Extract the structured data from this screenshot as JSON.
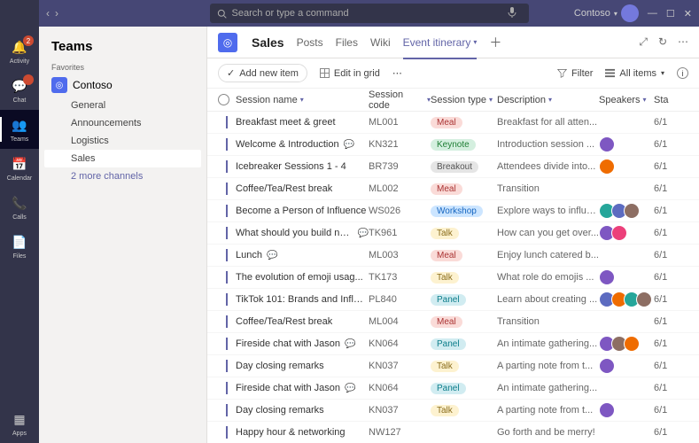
{
  "rail": {
    "items": [
      {
        "label": "Activity",
        "icon": "🔔",
        "badge": "2"
      },
      {
        "label": "Chat",
        "icon": "💬",
        "badge": " "
      },
      {
        "label": "Teams",
        "icon": "👥",
        "active": true
      },
      {
        "label": "Calendar",
        "icon": "📅"
      },
      {
        "label": "Calls",
        "icon": "📞"
      },
      {
        "label": "Files",
        "icon": "📄"
      }
    ],
    "apps_label": "Apps"
  },
  "search": {
    "placeholder": "Search or type a command"
  },
  "org": {
    "name": "Contoso"
  },
  "sidebar": {
    "title": "Teams",
    "favorites_label": "Favorites",
    "team_name": "Contoso",
    "channels": [
      {
        "name": "General"
      },
      {
        "name": "Announcements"
      },
      {
        "name": "Logistics"
      },
      {
        "name": "Sales",
        "selected": true
      },
      {
        "name": "2 more channels",
        "more": true
      }
    ]
  },
  "tabs": {
    "team_glyph": "◎",
    "title": "Sales",
    "items": [
      "Posts",
      "Files",
      "Wiki"
    ],
    "active_tab": "Event itinerary"
  },
  "cmd": {
    "new_item": "Add new item",
    "edit_grid": "Edit in grid",
    "filter": "Filter",
    "all_items": "All items"
  },
  "columns": {
    "name": "Session name",
    "code": "Session code",
    "type": "Session type",
    "desc": "Description",
    "speak": "Speakers",
    "start": "Sta"
  },
  "rows": [
    {
      "name": "Breakfast meet & greet",
      "code": "ML001",
      "type": "Meal",
      "typeClass": "meal",
      "desc": "Breakfast for all atten...",
      "speakers": [],
      "start": "6/1"
    },
    {
      "name": "Welcome & Introduction",
      "ind": true,
      "code": "KN321",
      "type": "Keynote",
      "typeClass": "keynote",
      "desc": "Introduction session ...",
      "speakers": [
        "a"
      ],
      "start": "6/1"
    },
    {
      "name": "Icebreaker Sessions 1 - 4",
      "code": "BR739",
      "type": "Breakout",
      "typeClass": "breakout",
      "desc": "Attendees divide into...",
      "speakers": [
        "b"
      ],
      "start": "6/1"
    },
    {
      "name": "Coffee/Tea/Rest break",
      "code": "ML002",
      "type": "Meal",
      "typeClass": "meal",
      "desc": "Transition",
      "speakers": [],
      "start": "6/1"
    },
    {
      "name": "Become a Person of Influence",
      "code": "WS026",
      "type": "Workshop",
      "typeClass": "workshop",
      "desc": "Explore ways to influe...",
      "speakers": [
        "c",
        "d",
        "e"
      ],
      "start": "6/1"
    },
    {
      "name": "What should you build next?",
      "ind": true,
      "code": "TK961",
      "type": "Talk",
      "typeClass": "talk",
      "desc": "How can you get over...",
      "speakers": [
        "a",
        "f"
      ],
      "start": "6/1"
    },
    {
      "name": "Lunch",
      "ind": true,
      "code": "ML003",
      "type": "Meal",
      "typeClass": "meal",
      "desc": "Enjoy lunch catered b...",
      "speakers": [],
      "start": "6/1"
    },
    {
      "name": "The evolution of emoji usag...",
      "code": "TK173",
      "type": "Talk",
      "typeClass": "talk",
      "desc": "What role do emojis ...",
      "speakers": [
        "a"
      ],
      "start": "6/1"
    },
    {
      "name": "TikTok 101: Brands and Influe...",
      "code": "PL840",
      "type": "Panel",
      "typeClass": "panel",
      "desc": "Learn about creating ...",
      "speakers": [
        "d",
        "b",
        "c",
        "e"
      ],
      "start": "6/1"
    },
    {
      "name": "Coffee/Tea/Rest break",
      "code": "ML004",
      "type": "Meal",
      "typeClass": "meal",
      "desc": "Transition",
      "speakers": [],
      "start": "6/1"
    },
    {
      "name": "Fireside chat with Jason",
      "ind": true,
      "code": "KN064",
      "type": "Panel",
      "typeClass": "panel",
      "desc": "An intimate gathering...",
      "speakers": [
        "a",
        "e",
        "b"
      ],
      "start": "6/1"
    },
    {
      "name": "Day closing remarks",
      "code": "KN037",
      "type": "Talk",
      "typeClass": "talk",
      "desc": "A parting note from t...",
      "speakers": [
        "a"
      ],
      "start": "6/1"
    },
    {
      "name": "Fireside chat with Jason",
      "ind": true,
      "code": "KN064",
      "type": "Panel",
      "typeClass": "panel",
      "desc": "An intimate gathering...",
      "speakers": [],
      "start": "6/1"
    },
    {
      "name": "Day closing remarks",
      "code": "KN037",
      "type": "Talk",
      "typeClass": "talk",
      "desc": "A parting note from t...",
      "speakers": [
        "a"
      ],
      "start": "6/1"
    },
    {
      "name": "Happy hour & networking",
      "code": "NW127",
      "type": "",
      "typeClass": "",
      "desc": "Go forth and be merry!",
      "speakers": [],
      "start": "6/1"
    }
  ]
}
